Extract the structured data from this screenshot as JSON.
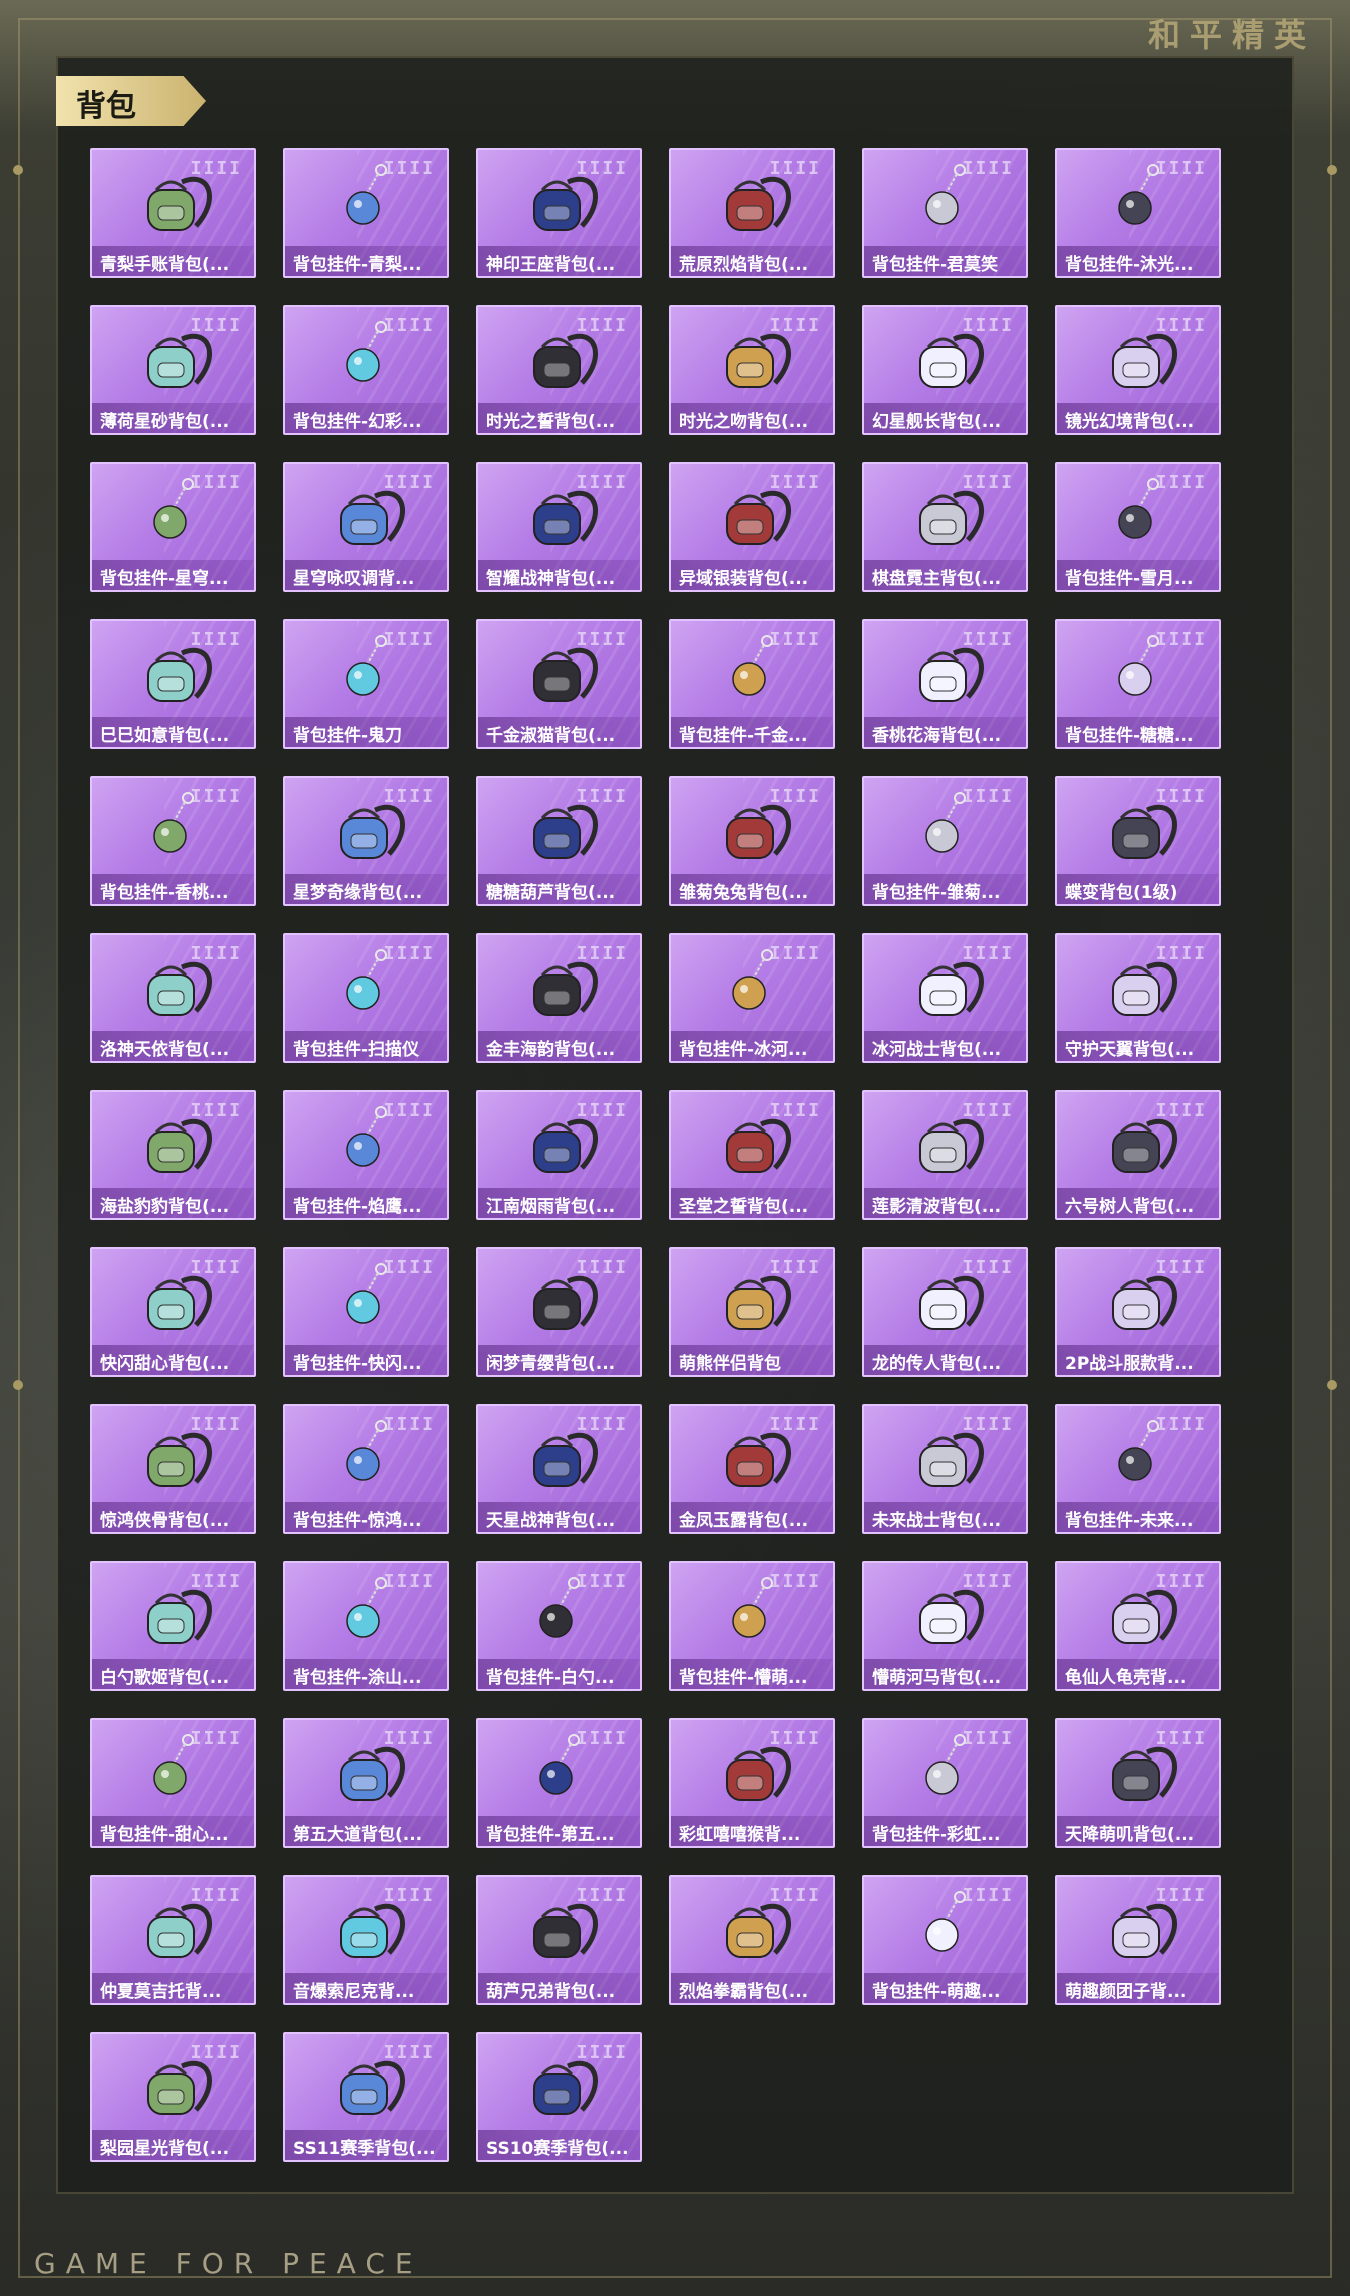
{
  "brand": {
    "top": "和平精英",
    "bottom": "GAME FOR PEACE"
  },
  "section": {
    "title": "背包"
  },
  "rarity_mark": "IIII",
  "items": [
    {
      "label": "青梨手账背包(...",
      "icon": "backpack-icon"
    },
    {
      "label": "背包挂件-青梨...",
      "icon": "charm-icon"
    },
    {
      "label": "神印王座背包(...",
      "icon": "backpack-icon"
    },
    {
      "label": "荒原烈焰背包(...",
      "icon": "backpack-icon"
    },
    {
      "label": "背包挂件-君莫笑",
      "icon": "charm-icon"
    },
    {
      "label": "背包挂件-沐光...",
      "icon": "charm-icon"
    },
    {
      "label": "薄荷星砂背包(...",
      "icon": "backpack-icon"
    },
    {
      "label": "背包挂件-幻彩...",
      "icon": "charm-icon"
    },
    {
      "label": "时光之誓背包(...",
      "icon": "backpack-icon"
    },
    {
      "label": "时光之吻背包(...",
      "icon": "backpack-icon"
    },
    {
      "label": "幻星舰长背包(...",
      "icon": "backpack-icon"
    },
    {
      "label": "镜光幻境背包(...",
      "icon": "backpack-icon"
    },
    {
      "label": "背包挂件-星穹...",
      "icon": "charm-icon"
    },
    {
      "label": "星穹咏叹调背...",
      "icon": "backpack-icon"
    },
    {
      "label": "智耀战神背包(...",
      "icon": "backpack-icon"
    },
    {
      "label": "异域银装背包(...",
      "icon": "backpack-icon"
    },
    {
      "label": "棋盘霓主背包(...",
      "icon": "backpack-icon"
    },
    {
      "label": "背包挂件-雪月...",
      "icon": "charm-icon"
    },
    {
      "label": "巳巳如意背包(...",
      "icon": "backpack-icon"
    },
    {
      "label": "背包挂件-鬼刀",
      "icon": "charm-icon"
    },
    {
      "label": "千金淑猫背包(...",
      "icon": "backpack-icon"
    },
    {
      "label": "背包挂件-千金...",
      "icon": "charm-icon"
    },
    {
      "label": "香桃花海背包(...",
      "icon": "backpack-icon"
    },
    {
      "label": "背包挂件-糖糖...",
      "icon": "charm-icon"
    },
    {
      "label": "背包挂件-香桃...",
      "icon": "charm-icon"
    },
    {
      "label": "星梦奇缘背包(...",
      "icon": "backpack-icon"
    },
    {
      "label": "糖糖葫芦背包(...",
      "icon": "backpack-icon"
    },
    {
      "label": "雏菊兔兔背包(...",
      "icon": "backpack-icon"
    },
    {
      "label": "背包挂件-雏菊...",
      "icon": "charm-icon"
    },
    {
      "label": "蝶变背包(1级)",
      "icon": "backpack-icon"
    },
    {
      "label": "洛神天依背包(...",
      "icon": "backpack-icon"
    },
    {
      "label": "背包挂件-扫描仪",
      "icon": "charm-icon"
    },
    {
      "label": "金丰海韵背包(...",
      "icon": "backpack-icon"
    },
    {
      "label": "背包挂件-冰河...",
      "icon": "charm-icon"
    },
    {
      "label": "冰河战士背包(...",
      "icon": "backpack-icon"
    },
    {
      "label": "守护天翼背包(...",
      "icon": "backpack-icon"
    },
    {
      "label": "海盐豹豹背包(...",
      "icon": "backpack-icon"
    },
    {
      "label": "背包挂件-焰鹰...",
      "icon": "charm-icon"
    },
    {
      "label": "江南烟雨背包(...",
      "icon": "backpack-icon"
    },
    {
      "label": "圣堂之誓背包(...",
      "icon": "backpack-icon"
    },
    {
      "label": "莲影清波背包(...",
      "icon": "backpack-icon"
    },
    {
      "label": "六号树人背包(...",
      "icon": "backpack-icon"
    },
    {
      "label": "快闪甜心背包(...",
      "icon": "backpack-icon"
    },
    {
      "label": "背包挂件-快闪...",
      "icon": "charm-icon"
    },
    {
      "label": "闲梦青缨背包(...",
      "icon": "backpack-icon"
    },
    {
      "label": "萌熊伴侣背包",
      "icon": "backpack-icon"
    },
    {
      "label": "龙的传人背包(...",
      "icon": "backpack-icon"
    },
    {
      "label": "2P战斗服款背...",
      "icon": "backpack-icon"
    },
    {
      "label": "惊鸿侠骨背包(...",
      "icon": "backpack-icon"
    },
    {
      "label": "背包挂件-惊鸿...",
      "icon": "charm-icon"
    },
    {
      "label": "天星战神背包(...",
      "icon": "backpack-icon"
    },
    {
      "label": "金凤玉露背包(...",
      "icon": "backpack-icon"
    },
    {
      "label": "未来战士背包(...",
      "icon": "backpack-icon"
    },
    {
      "label": "背包挂件-未来...",
      "icon": "charm-icon"
    },
    {
      "label": "白勺歌姬背包(...",
      "icon": "backpack-icon"
    },
    {
      "label": "背包挂件-涂山...",
      "icon": "charm-icon"
    },
    {
      "label": "背包挂件-白勺...",
      "icon": "charm-icon"
    },
    {
      "label": "背包挂件-懵萌...",
      "icon": "charm-icon"
    },
    {
      "label": "懵萌河马背包(...",
      "icon": "backpack-icon"
    },
    {
      "label": "龟仙人龟壳背...",
      "icon": "backpack-icon"
    },
    {
      "label": "背包挂件-甜心...",
      "icon": "charm-icon"
    },
    {
      "label": "第五大道背包(...",
      "icon": "backpack-icon"
    },
    {
      "label": "背包挂件-第五...",
      "icon": "charm-icon"
    },
    {
      "label": "彩虹嘻嘻猴背...",
      "icon": "backpack-icon"
    },
    {
      "label": "背包挂件-彩虹...",
      "icon": "charm-icon"
    },
    {
      "label": "天降萌叽背包(...",
      "icon": "backpack-icon"
    },
    {
      "label": "仲夏莫吉托背...",
      "icon": "backpack-icon"
    },
    {
      "label": "音爆索尼克背...",
      "icon": "backpack-icon"
    },
    {
      "label": "葫芦兄弟背包(...",
      "icon": "backpack-icon"
    },
    {
      "label": "烈焰拳霸背包(...",
      "icon": "backpack-icon"
    },
    {
      "label": "背包挂件-萌趣...",
      "icon": "charm-icon"
    },
    {
      "label": "萌趣颜团子背...",
      "icon": "backpack-icon"
    },
    {
      "label": "梨园星光背包(...",
      "icon": "backpack-icon"
    },
    {
      "label": "SS11赛季背包(...",
      "icon": "backpack-icon"
    },
    {
      "label": "SS10赛季背包(...",
      "icon": "backpack-icon"
    }
  ]
}
